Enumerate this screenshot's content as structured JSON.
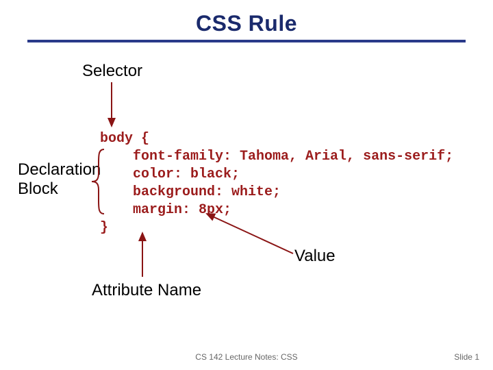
{
  "title": "CSS Rule",
  "labels": {
    "selector": "Selector",
    "declaration_block_line1": "Declaration",
    "declaration_block_line2": "Block",
    "attribute_name": "Attribute Name",
    "value": "Value"
  },
  "code": {
    "line1": "body {",
    "line2": "    font-family: Tahoma, Arial, sans-serif;",
    "line3": "    color: black;",
    "line4": "    background: white;",
    "line5": "    margin: 8px;",
    "line6": "}"
  },
  "footer": {
    "center": "CS 142 Lecture Notes: CSS",
    "right": "Slide 1"
  },
  "colors": {
    "title": "#1a2a6c",
    "rule": "#2a3a8a",
    "code": "#9b1c1c",
    "arrow": "#8a1414"
  }
}
